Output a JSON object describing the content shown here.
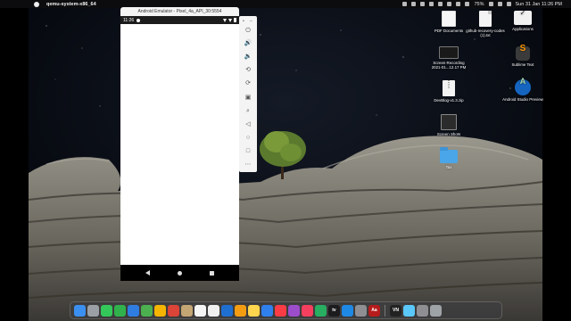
{
  "menubar": {
    "app_name": "qemu-system-x86_64",
    "battery": "75%",
    "clock": "Sun 31 Jan  11:26 PM"
  },
  "emulator": {
    "title": "Android Emulator - Pixel_4a_API_30:5554",
    "status_time": "11:26",
    "toolbar_icons": [
      "close-icon",
      "minimize-icon",
      "power-icon",
      "volume-up-icon",
      "volume-down-icon",
      "rotate-left-icon",
      "rotate-right-icon",
      "camera-icon",
      "zoom-icon",
      "back-icon",
      "home-icon",
      "overview-icon",
      "more-icon"
    ]
  },
  "desktop": {
    "icons": [
      {
        "label": "PDF Documents",
        "kind": "pdf"
      },
      {
        "label": "github-recovery-codes (1).txt",
        "kind": "doc"
      },
      {
        "label": "Applications",
        "kind": "app"
      },
      {
        "label": "Screen Recording 2021-01...12.17 PM",
        "kind": "rec"
      },
      {
        "label": "Sublime Text",
        "kind": "sublime"
      },
      {
        "label": "DevBlog-v1.3.zip",
        "kind": "zip"
      },
      {
        "label": "Android Studio Preview",
        "kind": "studio"
      },
      {
        "label": "Screen Shots",
        "kind": "screenshots"
      },
      {
        "label": "Tax",
        "kind": "folder"
      }
    ]
  },
  "dock": {
    "apps": [
      {
        "name": "finder",
        "color": "#3b8ff0"
      },
      {
        "name": "launchpad",
        "color": "#9aa0a6"
      },
      {
        "name": "messages",
        "color": "#34c759"
      },
      {
        "name": "facetime",
        "color": "#30b14c"
      },
      {
        "name": "mail",
        "color": "#2f7de1"
      },
      {
        "name": "maps",
        "color": "#4cb050"
      },
      {
        "name": "photos",
        "color": "#f4b400"
      },
      {
        "name": "chrome",
        "color": "#db4437"
      },
      {
        "name": "contacts",
        "color": "#c4a574"
      },
      {
        "name": "calendar",
        "color": "#f5f5f5"
      },
      {
        "name": "reminders",
        "color": "#f0f0f0"
      },
      {
        "name": "finder-2",
        "color": "#1f6fd1"
      },
      {
        "name": "pages",
        "color": "#f39c12"
      },
      {
        "name": "notes",
        "color": "#ffd54f"
      },
      {
        "name": "keynote",
        "color": "#2f80ed"
      },
      {
        "name": "music",
        "color": "#fc3c44"
      },
      {
        "name": "podcasts",
        "color": "#9c4dcc"
      },
      {
        "name": "news",
        "color": "#f43f5e"
      },
      {
        "name": "numbers",
        "color": "#27ae60"
      },
      {
        "name": "apple-tv",
        "color": "#1c1c1e"
      },
      {
        "name": "app-store",
        "color": "#1e88e5"
      },
      {
        "name": "settings",
        "color": "#8e8e93"
      },
      {
        "name": "dictionary",
        "color": "#b71c1c"
      },
      {
        "name": "vn",
        "color": "#222"
      },
      {
        "name": "preview",
        "color": "#5ac8fa"
      },
      {
        "name": "screenshot-app",
        "color": "#8e8e93"
      },
      {
        "name": "trash",
        "color": "#9ea3a8"
      }
    ],
    "labels": {
      "tv": "tv",
      "dictionary": "Aa",
      "vn": "VN"
    }
  }
}
